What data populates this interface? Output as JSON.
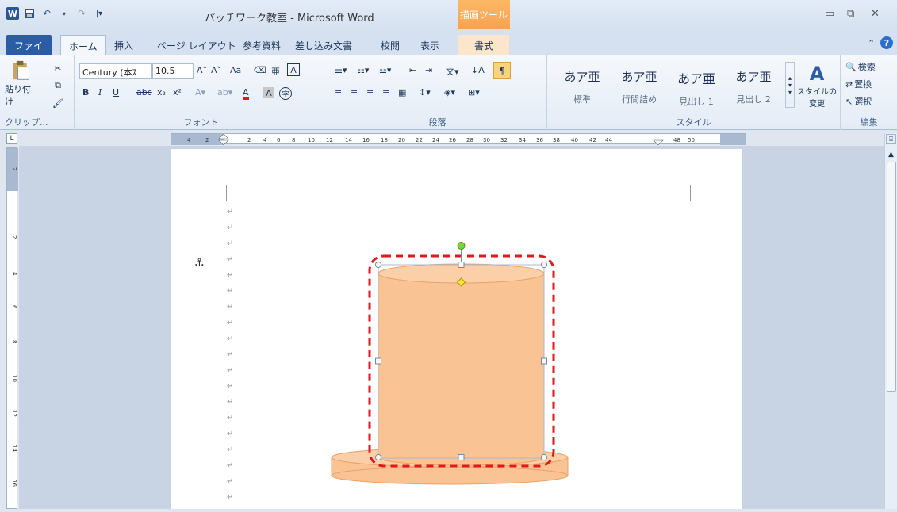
{
  "window": {
    "title": "パッチワーク教室 - Microsoft Word",
    "contextual_tab": "描画ツール"
  },
  "tabs": {
    "file": "ファイル",
    "home": "ホーム",
    "insert": "挿入",
    "page_layout": "ページ レイアウト",
    "references": "参考資料",
    "mailings": "差し込み文書",
    "review": "校閲",
    "view": "表示",
    "format": "書式"
  },
  "ribbon": {
    "clipboard": {
      "label": "クリップ...",
      "paste": "貼り付け"
    },
    "font": {
      "label": "フォント",
      "font_name": "Century (本ｽ",
      "font_size": "10.5",
      "bold": "B",
      "italic": "I",
      "underline": "U",
      "strike": "abc",
      "subscript": "x₂",
      "superscript": "x²"
    },
    "paragraph": {
      "label": "段落"
    },
    "styles": {
      "label": "スタイル",
      "items": [
        {
          "sample": "あア亜",
          "name": "標準"
        },
        {
          "sample": "あア亜",
          "name": "行間詰め"
        },
        {
          "sample": "あア亜",
          "name": "見出し 1"
        },
        {
          "sample": "あア亜",
          "name": "見出し 2"
        }
      ],
      "change_styles": "スタイルの\n変更"
    },
    "editing": {
      "label": "編集",
      "find": "検索",
      "replace": "置換",
      "select": "選択"
    }
  },
  "ruler": {
    "labels": [
      "4",
      "2",
      "2",
      "4",
      "6",
      "8",
      "10",
      "12",
      "14",
      "16",
      "18",
      "20",
      "22",
      "24",
      "26",
      "28",
      "30",
      "32",
      "34",
      "36",
      "38",
      "40",
      "42",
      "44",
      "48",
      "50"
    ],
    "vertical_labels": [
      "2",
      "2",
      "4",
      "6",
      "8",
      "10",
      "12",
      "14",
      "16"
    ],
    "corner": "L"
  },
  "document": {
    "paragraph_mark": "↵",
    "anchor": "⚓"
  },
  "colors": {
    "shape_fill": "#f9c393",
    "shape_stroke": "#e7a36b",
    "selection_dash": "#e0191c",
    "accent": "#2a5ca8",
    "contextual": "#f7a350"
  }
}
